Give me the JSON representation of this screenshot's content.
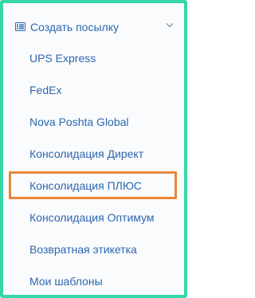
{
  "menu": {
    "header": {
      "label": "Создать посылку",
      "icon": "list-icon",
      "toggle_icon": "chevron-down-icon",
      "expanded": true
    },
    "items": [
      {
        "label": "UPS Express"
      },
      {
        "label": "FedEx"
      },
      {
        "label": "Nova Poshta Global"
      },
      {
        "label": "Консолидация Директ"
      },
      {
        "label": "Консолидация ПЛЮС",
        "highlighted": true
      },
      {
        "label": "Консолидация Оптимум"
      },
      {
        "label": "Возвратная этикетка"
      },
      {
        "label": "Мои шаблоны"
      }
    ]
  },
  "colors": {
    "frame_border": "#35d6a8",
    "link_text": "#2c67b0",
    "highlight_border": "#e8873a",
    "chevron": "#8a93a0"
  }
}
